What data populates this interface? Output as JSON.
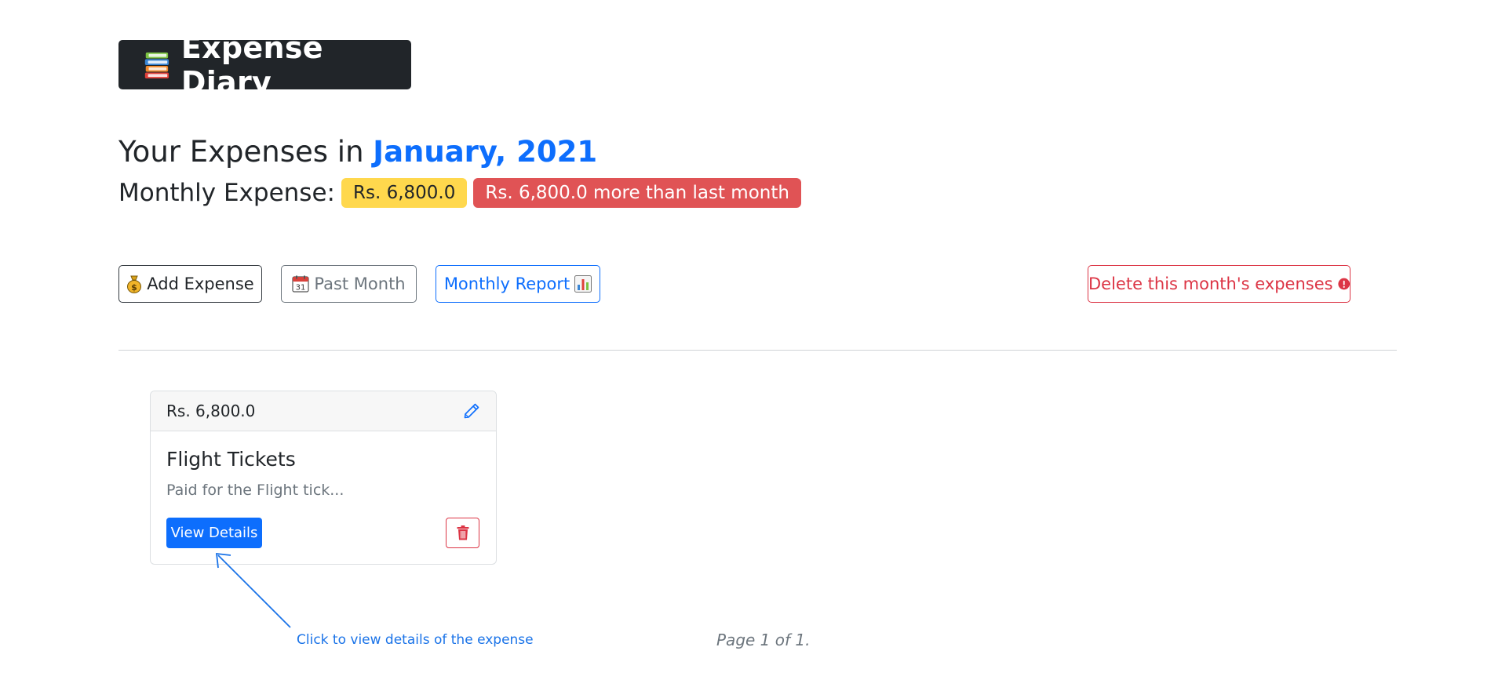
{
  "brand": {
    "title": "Expense Diary",
    "icon": "books-icon"
  },
  "heading": {
    "prefix": "Your Expenses in",
    "month": "January, 2021"
  },
  "monthly": {
    "label": "Monthly Expense:",
    "total": "Rs. 6,800.0",
    "comparison": "Rs. 6,800.0 more than last month"
  },
  "actions": {
    "add_expense": "Add Expense",
    "past_month": "Past Month",
    "monthly_report": "Monthly Report",
    "delete_month": "Delete this month's expenses"
  },
  "expenses": [
    {
      "amount": "Rs. 6,800.0",
      "title": "Flight Tickets",
      "description": "Paid for the Flight tick...",
      "view_label": "View Details"
    }
  ],
  "hint": "Click to view details of the expense",
  "pagination": "Page 1 of 1.",
  "colors": {
    "primary": "#0d6efd",
    "danger": "#dc3545",
    "warning": "#ffd84d",
    "dark": "#212529",
    "secondary": "#6c757d"
  }
}
